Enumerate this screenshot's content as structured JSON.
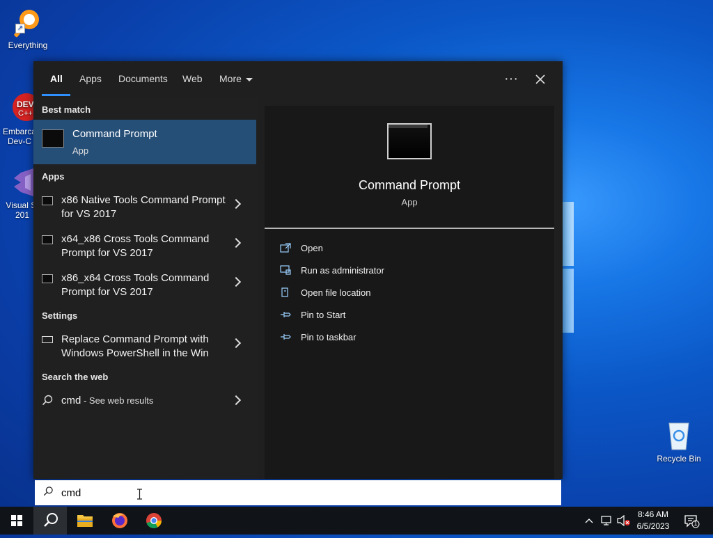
{
  "desktop": {
    "icons": [
      {
        "label": "Everything"
      },
      {
        "label": "Embarca\nDev-C"
      },
      {
        "label": "Visual St\n201"
      },
      {
        "label": "Recycle Bin"
      }
    ]
  },
  "search_panel": {
    "tabs": [
      {
        "label": "All"
      },
      {
        "label": "Apps"
      },
      {
        "label": "Documents"
      },
      {
        "label": "Web"
      },
      {
        "label": "More"
      }
    ],
    "more_options_label": "···",
    "close_label": "✕",
    "best_match": {
      "heading": "Best match",
      "name": "Command Prompt",
      "type": "App"
    },
    "apps": {
      "heading": "Apps",
      "items": [
        {
          "label": "x86 Native Tools Command Prompt for VS 2017"
        },
        {
          "label": "x64_x86 Cross Tools Command Prompt for VS 2017"
        },
        {
          "label": "x86_x64 Cross Tools Command Prompt for VS 2017"
        }
      ]
    },
    "settings": {
      "heading": "Settings",
      "items": [
        {
          "label": "Replace Command Prompt with Windows PowerShell in the Win"
        }
      ]
    },
    "web": {
      "heading": "Search the web",
      "query": "cmd",
      "suffix": " - See web results"
    },
    "preview": {
      "name": "Command Prompt",
      "type": "App",
      "actions": [
        {
          "label": "Open",
          "icon": "open-icon"
        },
        {
          "label": "Run as administrator",
          "icon": "shield-icon"
        },
        {
          "label": "Open file location",
          "icon": "file-location-icon"
        },
        {
          "label": "Pin to Start",
          "icon": "pin-icon"
        },
        {
          "label": "Pin to taskbar",
          "icon": "pin-icon"
        }
      ]
    }
  },
  "search_box": {
    "value": "cmd"
  },
  "taskbar": {
    "time": "8:46 AM",
    "date": "6/5/2023",
    "notification_count": "1"
  },
  "colors": {
    "accent": "#2f8fff",
    "best_match_bg": "#264f78",
    "panel_bg": "#1f1f1f"
  }
}
